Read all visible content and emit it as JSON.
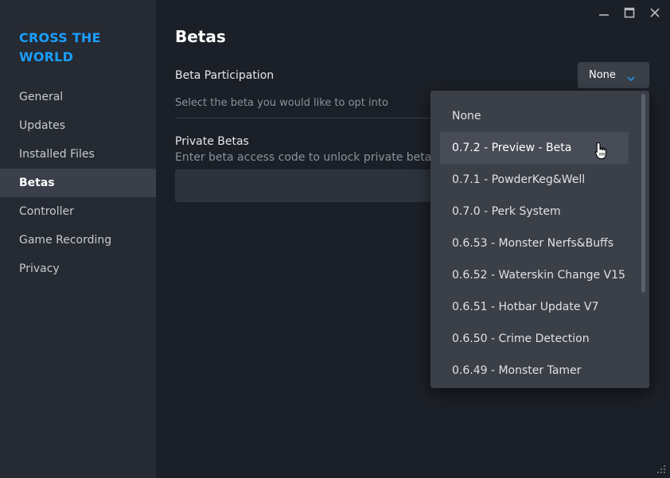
{
  "sidebar": {
    "game_title": "CROSS THE WORLD",
    "items": [
      {
        "label": "General",
        "active": false
      },
      {
        "label": "Updates",
        "active": false
      },
      {
        "label": "Installed Files",
        "active": false
      },
      {
        "label": "Betas",
        "active": true
      },
      {
        "label": "Controller",
        "active": false
      },
      {
        "label": "Game Recording",
        "active": false
      },
      {
        "label": "Privacy",
        "active": false
      }
    ]
  },
  "window_controls": {
    "icons": [
      "minimize-icon",
      "maximize-icon",
      "close-icon"
    ]
  },
  "main": {
    "title": "Betas",
    "beta_participation": {
      "label": "Beta Participation",
      "description": "Select the beta you would like to opt into",
      "selected": "None"
    },
    "private_betas": {
      "label": "Private Betas",
      "description": "Enter beta access code to unlock private betas:",
      "input_value": "",
      "input_placeholder": ""
    }
  },
  "dropdown_menu": {
    "options": [
      "None",
      "0.7.2 - Preview - Beta",
      "0.7.1 - PowderKeg&Well",
      "0.7.0 - Perk System",
      "0.6.53 - Monster Nerfs&Buffs",
      "0.6.52 - Waterskin Change V15",
      "0.6.51 - Hotbar Update V7",
      "0.6.50 - Crime Detection",
      "0.6.49 - Monster Tamer"
    ],
    "hovered_index": 1
  },
  "colors": {
    "accent": "#1a9fff",
    "sidebar_bg": "#252a33",
    "main_bg": "#1b1f27",
    "menu_bg": "#3a3f48"
  }
}
